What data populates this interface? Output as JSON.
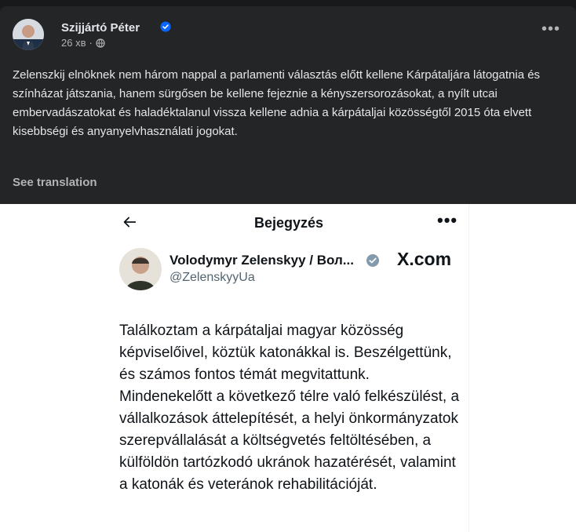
{
  "post": {
    "author": "Szijjártó Péter",
    "time": "26 хв",
    "separator": "·",
    "text": "Zelenszkij elnöknek nem három nappal a parlamenti választás előtt kellene Kárpátaljára látogatnia és színházat játszania, hanem sürgősen be kellene fejeznie a kényszersorozásokat, a nyílt utcai embervadászatokat és haladéktalanul vissza kellene adnia a kárpátaljai közösségtől 2015 óta elvett kisebbségi és anyanyelvhasználati jogokat.",
    "see_translation": "See translation",
    "more_icon": "more-horizontal-icon",
    "privacy_icon": "globe-icon"
  },
  "embed": {
    "title": "Bejegyzés",
    "author_name": "Volodymyr Zelenskyy / Вол...",
    "handle": "@ZelenskyyUa",
    "site": "X.com",
    "body": "Találkoztam a kárpátaljai magyar közösség képviselőivel, köztük katonákkal is. Beszélgettünk, és számos fontos témát megvitattunk. Mindenekelőtt a következő télre való felkészülést, a vállalkozások áttelepítését, a helyi önkormányzatok szerepvállalását a költségvetés feltöltésében, a külföldön tartózkodó ukránok hazatérését, valamint a katonák és veteránok rehabilitációját."
  },
  "colors": {
    "background": "#18191a",
    "card": "#242526",
    "primary_text": "#e4e6eb",
    "secondary_text": "#b0b3b8",
    "verified_blue": "#0866ff"
  }
}
